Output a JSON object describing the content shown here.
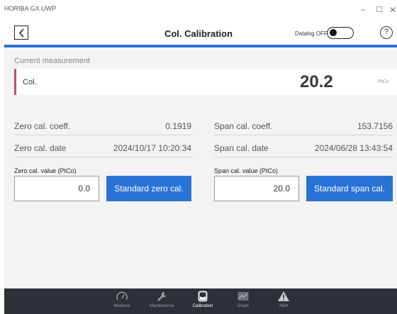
{
  "window": {
    "app_title": "HORIBA GX.UWP",
    "minimize": "–",
    "maximize": "☐",
    "close": "✕"
  },
  "header": {
    "title": "Col. Calibration",
    "datalog_label": "Datalog OFF",
    "help": "?"
  },
  "current_measurement": {
    "section_label": "Current measurement",
    "name": "Col.",
    "value": "20.2",
    "unit": "PtCo"
  },
  "zero": {
    "coeff_label": "Zero cal. coeff.",
    "coeff_value": "0.1919",
    "date_label": "Zero cal. date",
    "date_value": "2024/10/17 10:20:34",
    "field_label": "Zero cal. value (PtCo)",
    "field_value": "0.0",
    "button_label": "Standard zero cal."
  },
  "span": {
    "coeff_label": "Span cal. coeff.",
    "coeff_value": "153.7156",
    "date_label": "Span cal. date",
    "date_value": "2024/06/28 13:43:54",
    "field_label": "Span cal. value (PtCo)",
    "field_value": "20.0",
    "button_label": "Standard span cal."
  },
  "nav": [
    {
      "label": "Measure",
      "icon": "gauge-icon"
    },
    {
      "label": "Maintenance",
      "icon": "wrench-icon"
    },
    {
      "label": "Calibration",
      "icon": "calibration-icon",
      "active": true
    },
    {
      "label": "Graph",
      "icon": "graph-icon"
    },
    {
      "label": "Alert",
      "icon": "alert-icon"
    }
  ],
  "colors": {
    "accent": "#2a73d6",
    "nav_background": "#2e3037",
    "measurement_marker": "#c0506e"
  }
}
